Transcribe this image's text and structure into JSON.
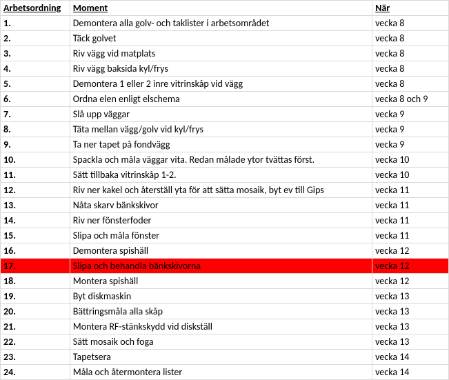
{
  "headers": {
    "col1": "Arbetsordning",
    "col2": "Moment",
    "col3": "När"
  },
  "rows": [
    {
      "n": "1.",
      "m": "Demontera alla golv- och taklister i arbetsområdet",
      "w": "vecka 8",
      "hl": false
    },
    {
      "n": "2.",
      "m": "Täck golvet",
      "w": "vecka 8",
      "hl": false
    },
    {
      "n": "3.",
      "m": "Riv vägg vid matplats",
      "w": "vecka 8",
      "hl": false
    },
    {
      "n": "4.",
      "m": "Riv vägg baksida kyl/frys",
      "w": "vecka 8",
      "hl": false
    },
    {
      "n": "5.",
      "m": "Demontera 1 eller 2 inre vitrinskåp vid vägg",
      "w": "vecka 8",
      "hl": false
    },
    {
      "n": "6.",
      "m": "Ordna elen enligt elschema",
      "w": "vecka 8 och 9",
      "hl": false
    },
    {
      "n": "7.",
      "m": "Slå upp väggar",
      "w": "vecka 9",
      "hl": false
    },
    {
      "n": "8.",
      "m": "Täta mellan vägg/golv vid kyl/frys",
      "w": "vecka 9",
      "hl": false
    },
    {
      "n": "9.",
      "m": "Ta ner tapet på fondvägg",
      "w": "vecka 9",
      "hl": false
    },
    {
      "n": "10.",
      "m": "Spackla och måla väggar vita. Redan målade ytor tvättas först.",
      "w": "vecka 10",
      "hl": false
    },
    {
      "n": "11.",
      "m": "Sätt tillbaka vitrinskåp 1-2.",
      "w": "vecka 10",
      "hl": false
    },
    {
      "n": "12.",
      "m": "Riv ner kakel och återställ yta för att sätta mosaik, byt ev till Gips",
      "w": "vecka 11",
      "hl": false
    },
    {
      "n": "13.",
      "m": "Nåta skarv bänkskivor",
      "w": "vecka 11",
      "hl": false
    },
    {
      "n": "14.",
      "m": "Riv ner fönsterfoder",
      "w": "vecka 11",
      "hl": false
    },
    {
      "n": "15.",
      "m": "Slipa och måla fönster",
      "w": "vecka 11",
      "hl": false
    },
    {
      "n": "16.",
      "m": "Demontera spishäll",
      "w": "vecka 12",
      "hl": false
    },
    {
      "n": "17.",
      "m": "Slipa och behandla bänkskivorna",
      "w": "vecka 12",
      "hl": true
    },
    {
      "n": "18.",
      "m": "Montera spishäll",
      "w": "vecka 12",
      "hl": false
    },
    {
      "n": "19.",
      "m": "Byt diskmaskin",
      "w": "vecka 13",
      "hl": false
    },
    {
      "n": "20.",
      "m": "Bättringsmåla alla skåp",
      "w": "vecka 13",
      "hl": false
    },
    {
      "n": "21.",
      "m": "Montera RF-stänkskydd vid diskställ",
      "w": "vecka 13",
      "hl": false
    },
    {
      "n": "22.",
      "m": "Sätt mosaik och foga",
      "w": "vecka 13",
      "hl": false
    },
    {
      "n": "23.",
      "m": "Tapetsera",
      "w": "vecka 14",
      "hl": false
    },
    {
      "n": "24.",
      "m": "Måla och återmontera lister",
      "w": "vecka 14",
      "hl": false
    }
  ]
}
